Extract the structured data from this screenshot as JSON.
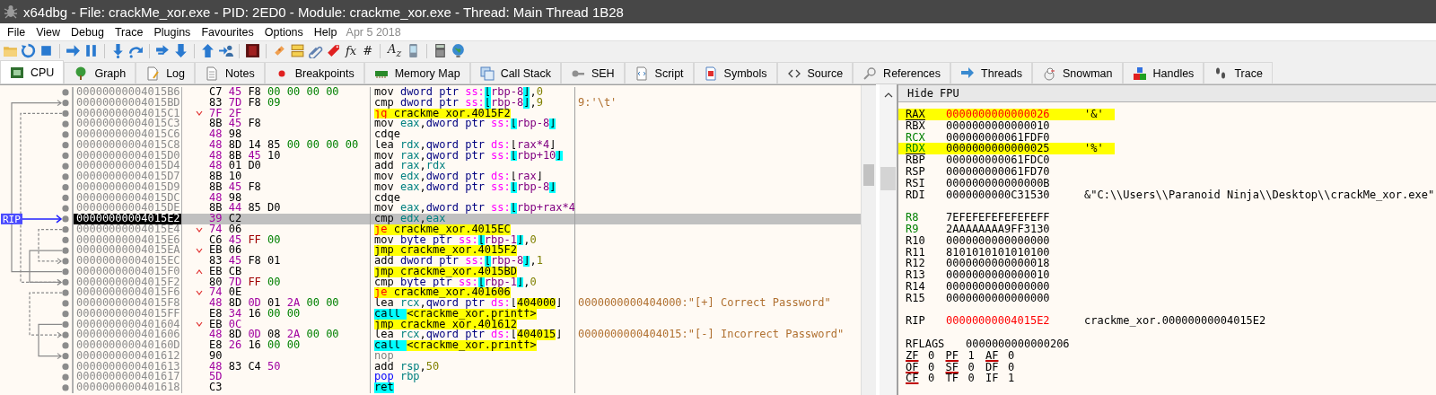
{
  "window": {
    "title": "x64dbg - File: crackMe_xor.exe - PID: 2ED0 - Module: crackme_xor.exe - Thread: Main Thread 1B28"
  },
  "menu": [
    "File",
    "View",
    "Debug",
    "Trace",
    "Plugins",
    "Favourites",
    "Options",
    "Help"
  ],
  "build_date": "Apr 5 2018",
  "toolbar": [
    {
      "kind": "folder"
    },
    {
      "kind": "restart"
    },
    {
      "kind": "stop"
    },
    {
      "kind": "sep"
    },
    {
      "kind": "run"
    },
    {
      "kind": "pause"
    },
    {
      "kind": "sep"
    },
    {
      "kind": "stepinto"
    },
    {
      "kind": "stepover"
    },
    {
      "kind": "sep"
    },
    {
      "kind": "runto"
    },
    {
      "kind": "down"
    },
    {
      "kind": "sep"
    },
    {
      "kind": "up"
    },
    {
      "kind": "user"
    },
    {
      "kind": "sep"
    },
    {
      "kind": "square"
    },
    {
      "kind": "sep"
    },
    {
      "kind": "bandage"
    },
    {
      "kind": "comment"
    },
    {
      "kind": "clip"
    },
    {
      "kind": "tag"
    },
    {
      "kind": "text",
      "text": "fx"
    },
    {
      "kind": "text",
      "text": "#"
    },
    {
      "kind": "sep"
    },
    {
      "kind": "text",
      "text": "A$_{z}$"
    },
    {
      "kind": "phone"
    },
    {
      "kind": "sep"
    },
    {
      "kind": "calc"
    },
    {
      "kind": "globe"
    }
  ],
  "tabs": [
    {
      "label": "CPU",
      "kind": "cpu",
      "selected": true
    },
    {
      "label": "Graph",
      "kind": "tree",
      "selected": false
    },
    {
      "label": "Log",
      "kind": "log",
      "selected": false
    },
    {
      "label": "Notes",
      "kind": "notes",
      "selected": false
    },
    {
      "label": "Breakpoints",
      "kind": "dot",
      "selected": false
    },
    {
      "label": "Memory Map",
      "kind": "memory",
      "selected": false
    },
    {
      "label": "Call Stack",
      "kind": "stack",
      "selected": false
    },
    {
      "label": "SEH",
      "kind": "key",
      "selected": false
    },
    {
      "label": "Script",
      "kind": "script",
      "selected": false
    },
    {
      "label": "Symbols",
      "kind": "symbols",
      "selected": false
    },
    {
      "label": "Source",
      "kind": "code",
      "selected": false
    },
    {
      "label": "References",
      "kind": "search",
      "selected": false
    },
    {
      "label": "Threads",
      "kind": "threads",
      "selected": false
    },
    {
      "label": "Snowman",
      "kind": "snowman",
      "selected": false
    },
    {
      "label": "Handles",
      "kind": "blocks",
      "selected": false
    },
    {
      "label": "Trace",
      "kind": "trace",
      "selected": false
    }
  ],
  "disassembly": {
    "rip_marker": "RIP",
    "rows": [
      {
        "address": "00000000004015B6",
        "bytes": [
          {
            "kind": "b",
            "text": "C7"
          },
          {
            "kind": "p",
            "text": "45"
          },
          {
            "kind": "b",
            "text": "F8"
          },
          {
            "kind": "g",
            "text": "00"
          },
          {
            "kind": "g",
            "text": "00"
          },
          {
            "kind": "g",
            "text": "00"
          },
          {
            "kind": "g",
            "text": "00"
          }
        ],
        "asm": [
          {
            "kind": "m",
            "text": "mov "
          },
          {
            "kind": "s",
            "text": "dword ptr "
          },
          {
            "kind": "sg",
            "text": "ss:"
          },
          {
            "kind": "bc",
            "text": "["
          },
          {
            "kind": "mm",
            "text": "rbp-8"
          },
          {
            "kind": "bc",
            "text": "]"
          },
          {
            "kind": "b",
            "text": ","
          },
          {
            "kind": "k",
            "text": "0"
          }
        ],
        "selected": false
      },
      {
        "address": "00000000004015BD",
        "bytes": [
          {
            "kind": "b",
            "text": "83"
          },
          {
            "kind": "p",
            "text": "7D"
          },
          {
            "kind": "b",
            "text": "F8"
          },
          {
            "kind": "g",
            "text": "09"
          }
        ],
        "asm": [
          {
            "kind": "m",
            "text": "cmp "
          },
          {
            "kind": "s",
            "text": "dword ptr "
          },
          {
            "kind": "sg",
            "text": "ss:"
          },
          {
            "kind": "bc",
            "text": "["
          },
          {
            "kind": "mm",
            "text": "rbp-8"
          },
          {
            "kind": "bc",
            "text": "]"
          },
          {
            "kind": "b",
            "text": ","
          },
          {
            "kind": "k",
            "text": "9"
          }
        ],
        "comment": "9:'\\t'",
        "selected": false
      },
      {
        "address": "00000000004015C1",
        "kind": "jump_down",
        "bytes": [
          {
            "kind": "p",
            "text": "7F"
          },
          {
            "kind": "p",
            "text": "2F"
          }
        ],
        "asm": [
          {
            "kind": "j",
            "text": "jg "
          },
          {
            "kind": "l",
            "text": "crackme_xor.4015F2"
          }
        ],
        "selected": false
      },
      {
        "address": "00000000004015C3",
        "bytes": [
          {
            "kind": "b",
            "text": "8B"
          },
          {
            "kind": "p",
            "text": "45"
          },
          {
            "kind": "b",
            "text": "F8"
          }
        ],
        "asm": [
          {
            "kind": "m",
            "text": "mov "
          },
          {
            "kind": "g",
            "text": "eax"
          },
          {
            "kind": "b",
            "text": ","
          },
          {
            "kind": "s",
            "text": "dword ptr "
          },
          {
            "kind": "sg",
            "text": "ss:"
          },
          {
            "kind": "bc",
            "text": "["
          },
          {
            "kind": "mm",
            "text": "rbp-8"
          },
          {
            "kind": "bc",
            "text": "]"
          }
        ],
        "selected": false
      },
      {
        "address": "00000000004015C6",
        "bytes": [
          {
            "kind": "p",
            "text": "48"
          },
          {
            "kind": "b",
            "text": "98"
          }
        ],
        "asm": [
          {
            "kind": "m",
            "text": "cdqe"
          }
        ],
        "selected": false
      },
      {
        "address": "00000000004015C8",
        "bytes": [
          {
            "kind": "p",
            "text": "48"
          },
          {
            "kind": "b",
            "text": "8D"
          },
          {
            "kind": "b",
            "text": "14"
          },
          {
            "kind": "b",
            "text": "85"
          },
          {
            "kind": "g",
            "text": "00"
          },
          {
            "kind": "g",
            "text": "00"
          },
          {
            "kind": "g",
            "text": "00"
          },
          {
            "kind": "g",
            "text": "00"
          }
        ],
        "asm": [
          {
            "kind": "m",
            "text": "lea "
          },
          {
            "kind": "g",
            "text": "rdx"
          },
          {
            "kind": "b",
            "text": ","
          },
          {
            "kind": "s",
            "text": "qword ptr "
          },
          {
            "kind": "sg",
            "text": "ds:"
          },
          {
            "kind": "b",
            "text": "["
          },
          {
            "kind": "mm",
            "text": "rax*4"
          },
          {
            "kind": "b",
            "text": "]"
          }
        ],
        "selected": false
      },
      {
        "address": "00000000004015D0",
        "bytes": [
          {
            "kind": "p",
            "text": "48"
          },
          {
            "kind": "b",
            "text": "8B"
          },
          {
            "kind": "p",
            "text": "45"
          },
          {
            "kind": "b",
            "text": "10"
          }
        ],
        "asm": [
          {
            "kind": "m",
            "text": "mov "
          },
          {
            "kind": "g",
            "text": "rax"
          },
          {
            "kind": "b",
            "text": ","
          },
          {
            "kind": "s",
            "text": "qword ptr "
          },
          {
            "kind": "sg",
            "text": "ss:"
          },
          {
            "kind": "bc",
            "text": "["
          },
          {
            "kind": "mm",
            "text": "rbp+10"
          },
          {
            "kind": "bc",
            "text": "]"
          }
        ],
        "selected": false
      },
      {
        "address": "00000000004015D4",
        "bytes": [
          {
            "kind": "p",
            "text": "48"
          },
          {
            "kind": "b",
            "text": "01"
          },
          {
            "kind": "b",
            "text": "D0"
          }
        ],
        "asm": [
          {
            "kind": "m",
            "text": "add "
          },
          {
            "kind": "g",
            "text": "rax"
          },
          {
            "kind": "b",
            "text": ","
          },
          {
            "kind": "g",
            "text": "rdx"
          }
        ],
        "selected": false
      },
      {
        "address": "00000000004015D7",
        "bytes": [
          {
            "kind": "b",
            "text": "8B"
          },
          {
            "kind": "b",
            "text": "10"
          }
        ],
        "asm": [
          {
            "kind": "m",
            "text": "mov "
          },
          {
            "kind": "g",
            "text": "edx"
          },
          {
            "kind": "b",
            "text": ","
          },
          {
            "kind": "s",
            "text": "dword ptr "
          },
          {
            "kind": "sg",
            "text": "ds:"
          },
          {
            "kind": "b",
            "text": "["
          },
          {
            "kind": "mm",
            "text": "rax"
          },
          {
            "kind": "b",
            "text": "]"
          }
        ],
        "selected": false
      },
      {
        "address": "00000000004015D9",
        "bytes": [
          {
            "kind": "b",
            "text": "8B"
          },
          {
            "kind": "p",
            "text": "45"
          },
          {
            "kind": "b",
            "text": "F8"
          }
        ],
        "asm": [
          {
            "kind": "m",
            "text": "mov "
          },
          {
            "kind": "g",
            "text": "eax"
          },
          {
            "kind": "b",
            "text": ","
          },
          {
            "kind": "s",
            "text": "dword ptr "
          },
          {
            "kind": "sg",
            "text": "ss:"
          },
          {
            "kind": "bc",
            "text": "["
          },
          {
            "kind": "mm",
            "text": "rbp-8"
          },
          {
            "kind": "bc",
            "text": "]"
          }
        ],
        "selected": false
      },
      {
        "address": "00000000004015DC",
        "bytes": [
          {
            "kind": "p",
            "text": "48"
          },
          {
            "kind": "b",
            "text": "98"
          }
        ],
        "asm": [
          {
            "kind": "m",
            "text": "cdqe"
          }
        ],
        "selected": false
      },
      {
        "address": "00000000004015DE",
        "bytes": [
          {
            "kind": "b",
            "text": "8B"
          },
          {
            "kind": "p",
            "text": "44"
          },
          {
            "kind": "b",
            "text": "85"
          },
          {
            "kind": "b",
            "text": "D0"
          }
        ],
        "asm": [
          {
            "kind": "m",
            "text": "mov "
          },
          {
            "kind": "g",
            "text": "eax"
          },
          {
            "kind": "b",
            "text": ","
          },
          {
            "kind": "s",
            "text": "dword ptr "
          },
          {
            "kind": "sg",
            "text": "ss:"
          },
          {
            "kind": "bc",
            "text": "["
          },
          {
            "kind": "mm",
            "text": "rbp+rax*4"
          }
        ],
        "selected": false
      },
      {
        "address": "00000000004015E2",
        "bytes": [
          {
            "kind": "p",
            "text": "39"
          },
          {
            "kind": "b",
            "text": "C2"
          }
        ],
        "asm": [
          {
            "kind": "m",
            "text": "cmp "
          },
          {
            "kind": "g",
            "text": "edx"
          },
          {
            "kind": "b",
            "text": ","
          },
          {
            "kind": "g",
            "text": "eax"
          }
        ],
        "selected": true
      },
      {
        "address": "00000000004015E4",
        "kind": "jump_down",
        "bytes": [
          {
            "kind": "p",
            "text": "74"
          },
          {
            "kind": "b",
            "text": "06"
          }
        ],
        "asm": [
          {
            "kind": "j",
            "text": "je "
          },
          {
            "kind": "l",
            "text": "crackme_xor.4015EC"
          }
        ],
        "selected": false
      },
      {
        "address": "00000000004015E6",
        "bytes": [
          {
            "kind": "b",
            "text": "C6"
          },
          {
            "kind": "p",
            "text": "45"
          },
          {
            "kind": "r",
            "text": "FF"
          },
          {
            "kind": "g",
            "text": "00"
          }
        ],
        "asm": [
          {
            "kind": "m",
            "text": "mov "
          },
          {
            "kind": "s",
            "text": "byte ptr "
          },
          {
            "kind": "sg",
            "text": "ss:"
          },
          {
            "kind": "bc",
            "text": "["
          },
          {
            "kind": "mm",
            "text": "rbp-1"
          },
          {
            "kind": "bc",
            "text": "]"
          },
          {
            "kind": "b",
            "text": ","
          },
          {
            "kind": "k",
            "text": "0"
          }
        ],
        "selected": false
      },
      {
        "address": "00000000004015EA",
        "kind": "jump_down",
        "bytes": [
          {
            "kind": "b",
            "text": "EB"
          },
          {
            "kind": "b",
            "text": "06"
          }
        ],
        "asm": [
          {
            "kind": "jm",
            "text": "jmp "
          },
          {
            "kind": "l",
            "text": "crackme_xor.4015F2"
          }
        ],
        "selected": false
      },
      {
        "address": "00000000004015EC",
        "bytes": [
          {
            "kind": "b",
            "text": "83"
          },
          {
            "kind": "p",
            "text": "45"
          },
          {
            "kind": "b",
            "text": "F8"
          },
          {
            "kind": "b",
            "text": "01"
          }
        ],
        "asm": [
          {
            "kind": "m",
            "text": "add "
          },
          {
            "kind": "s",
            "text": "dword ptr "
          },
          {
            "kind": "sg",
            "text": "ss:"
          },
          {
            "kind": "bc",
            "text": "["
          },
          {
            "kind": "mm",
            "text": "rbp-8"
          },
          {
            "kind": "bc",
            "text": "]"
          },
          {
            "kind": "b",
            "text": ","
          },
          {
            "kind": "k",
            "text": "1"
          }
        ],
        "selected": false
      },
      {
        "address": "00000000004015F0",
        "kind": "jump_up",
        "bytes": [
          {
            "kind": "b",
            "text": "EB"
          },
          {
            "kind": "b",
            "text": "CB"
          }
        ],
        "asm": [
          {
            "kind": "jm",
            "text": "jmp "
          },
          {
            "kind": "l",
            "text": "crackme_xor.4015BD"
          }
        ],
        "selected": false
      },
      {
        "address": "00000000004015F2",
        "bytes": [
          {
            "kind": "b",
            "text": "80"
          },
          {
            "kind": "p",
            "text": "7D"
          },
          {
            "kind": "r",
            "text": "FF"
          },
          {
            "kind": "g",
            "text": "00"
          }
        ],
        "asm": [
          {
            "kind": "m",
            "text": "cmp "
          },
          {
            "kind": "s",
            "text": "byte ptr "
          },
          {
            "kind": "sg",
            "text": "ss:"
          },
          {
            "kind": "bc",
            "text": "["
          },
          {
            "kind": "mm",
            "text": "rbp-1"
          },
          {
            "kind": "bc",
            "text": "]"
          },
          {
            "kind": "b",
            "text": ","
          },
          {
            "kind": "k",
            "text": "0"
          }
        ],
        "selected": false
      },
      {
        "address": "00000000004015F6",
        "kind": "jump_down",
        "bytes": [
          {
            "kind": "p",
            "text": "74"
          },
          {
            "kind": "b",
            "text": "0E"
          }
        ],
        "asm": [
          {
            "kind": "j",
            "text": "je "
          },
          {
            "kind": "l",
            "text": "crackme_xor.401606"
          }
        ],
        "selected": false
      },
      {
        "address": "00000000004015F8",
        "bytes": [
          {
            "kind": "p",
            "text": "48"
          },
          {
            "kind": "b",
            "text": "8D"
          },
          {
            "kind": "p",
            "text": "0D"
          },
          {
            "kind": "b",
            "text": "01"
          },
          {
            "kind": "p",
            "text": "2A"
          },
          {
            "kind": "g",
            "text": "00"
          },
          {
            "kind": "g",
            "text": "00"
          }
        ],
        "asm": [
          {
            "kind": "m",
            "text": "lea "
          },
          {
            "kind": "g",
            "text": "rcx"
          },
          {
            "kind": "b",
            "text": ","
          },
          {
            "kind": "s",
            "text": "qword ptr "
          },
          {
            "kind": "sg",
            "text": "ds:"
          },
          {
            "kind": "b",
            "text": "["
          },
          {
            "kind": "l",
            "text": "404000"
          },
          {
            "kind": "b",
            "text": "]"
          }
        ],
        "comment": "0000000000404000:\"[+] Correct Password\"",
        "selected": false
      },
      {
        "address": "00000000004015FF",
        "bytes": [
          {
            "kind": "b",
            "text": "E8"
          },
          {
            "kind": "p",
            "text": "34"
          },
          {
            "kind": "b",
            "text": "16"
          },
          {
            "kind": "g",
            "text": "00"
          },
          {
            "kind": "g",
            "text": "00"
          }
        ],
        "asm": [
          {
            "kind": "c",
            "text": "call "
          },
          {
            "kind": "l",
            "text": "<crackme_xor.printf>"
          }
        ],
        "selected": false
      },
      {
        "address": "0000000000401604",
        "kind": "jump_down",
        "bytes": [
          {
            "kind": "b",
            "text": "EB"
          },
          {
            "kind": "p",
            "text": "0C"
          }
        ],
        "asm": [
          {
            "kind": "jm",
            "text": "jmp "
          },
          {
            "kind": "l",
            "text": "crackme_xor.401612"
          }
        ],
        "selected": false
      },
      {
        "address": "0000000000401606",
        "bytes": [
          {
            "kind": "p",
            "text": "48"
          },
          {
            "kind": "b",
            "text": "8D"
          },
          {
            "kind": "p",
            "text": "0D"
          },
          {
            "kind": "b",
            "text": "08"
          },
          {
            "kind": "p",
            "text": "2A"
          },
          {
            "kind": "g",
            "text": "00"
          },
          {
            "kind": "g",
            "text": "00"
          }
        ],
        "asm": [
          {
            "kind": "m",
            "text": "lea "
          },
          {
            "kind": "g",
            "text": "rcx"
          },
          {
            "kind": "b",
            "text": ","
          },
          {
            "kind": "s",
            "text": "qword ptr "
          },
          {
            "kind": "sg",
            "text": "ds:"
          },
          {
            "kind": "b",
            "text": "["
          },
          {
            "kind": "l",
            "text": "404015"
          },
          {
            "kind": "b",
            "text": "]"
          }
        ],
        "comment": "0000000000404015:\"[-] Incorrect Password\"",
        "selected": false
      },
      {
        "address": "000000000040160D",
        "bytes": [
          {
            "kind": "b",
            "text": "E8"
          },
          {
            "kind": "p",
            "text": "26"
          },
          {
            "kind": "b",
            "text": "16"
          },
          {
            "kind": "g",
            "text": "00"
          },
          {
            "kind": "g",
            "text": "00"
          }
        ],
        "asm": [
          {
            "kind": "c",
            "text": "call "
          },
          {
            "kind": "l",
            "text": "<crackme_xor.printf>"
          }
        ],
        "selected": false
      },
      {
        "address": "0000000000401612",
        "bytes": [
          {
            "kind": "b",
            "text": "90"
          }
        ],
        "asm": [
          {
            "kind": "n",
            "text": "nop"
          }
        ],
        "selected": false
      },
      {
        "address": "0000000000401613",
        "bytes": [
          {
            "kind": "p",
            "text": "48"
          },
          {
            "kind": "b",
            "text": "83"
          },
          {
            "kind": "b",
            "text": "C4"
          },
          {
            "kind": "p",
            "text": "50"
          }
        ],
        "asm": [
          {
            "kind": "m",
            "text": "add "
          },
          {
            "kind": "g",
            "text": "rsp"
          },
          {
            "kind": "b",
            "text": ","
          },
          {
            "kind": "k",
            "text": "50"
          }
        ],
        "selected": false
      },
      {
        "address": "0000000000401617",
        "bytes": [
          {
            "kind": "p",
            "text": "5D"
          }
        ],
        "asm": [
          {
            "kind": "pp",
            "text": "pop "
          },
          {
            "kind": "g",
            "text": "rbp"
          }
        ],
        "selected": false
      },
      {
        "address": "0000000000401618",
        "bytes": [
          {
            "kind": "b",
            "text": "C3"
          }
        ],
        "asm": [
          {
            "kind": "c",
            "text": "ret"
          }
        ],
        "selected": false
      }
    ]
  },
  "registers": {
    "header_button": "Hide FPU",
    "groups": [
      [
        {
          "name": "RAX",
          "value": "0000000000000026",
          "comment": "'&'",
          "changed": true,
          "highlighted": true,
          "underlined": true,
          "argument": false
        },
        {
          "name": "RBX",
          "value": "0000000000000010",
          "changed": false,
          "highlighted": false,
          "underlined": false,
          "argument": false
        },
        {
          "name": "RCX",
          "value": "000000000061FDF0",
          "changed": false,
          "highlighted": false,
          "underlined": false,
          "argument": true
        },
        {
          "name": "RDX",
          "value": "0000000000000025",
          "comment": "'%'",
          "changed": false,
          "highlighted": true,
          "underlined": true,
          "argument": true
        },
        {
          "name": "RBP",
          "value": "000000000061FDC0",
          "changed": false,
          "highlighted": false,
          "underlined": false,
          "argument": false
        },
        {
          "name": "RSP",
          "value": "000000000061FD70",
          "changed": false,
          "highlighted": false,
          "underlined": false,
          "argument": false
        },
        {
          "name": "RSI",
          "value": "000000000000000B",
          "changed": false,
          "highlighted": false,
          "underlined": false,
          "argument": false
        },
        {
          "name": "RDI",
          "value": "0000000000C31530",
          "comment": "&\"C:\\\\Users\\\\Paranoid Ninja\\\\Desktop\\\\crackMe_xor.exe\"",
          "changed": false,
          "highlighted": false,
          "underlined": false,
          "argument": false
        }
      ],
      [
        {
          "name": "R8",
          "value": "7EFEFEFEFEFEFEFF",
          "changed": false,
          "highlighted": false,
          "underlined": false,
          "argument": true
        },
        {
          "name": "R9",
          "value": "2AAAAAAAA9FF3130",
          "changed": false,
          "highlighted": false,
          "underlined": false,
          "argument": true
        },
        {
          "name": "R10",
          "value": "0000000000000000",
          "changed": false,
          "highlighted": false,
          "underlined": false,
          "argument": false
        },
        {
          "name": "R11",
          "value": "8101010101010100",
          "changed": false,
          "highlighted": false,
          "underlined": false,
          "argument": false
        },
        {
          "name": "R12",
          "value": "0000000000000018",
          "changed": false,
          "highlighted": false,
          "underlined": false,
          "argument": false
        },
        {
          "name": "R13",
          "value": "0000000000000010",
          "changed": false,
          "highlighted": false,
          "underlined": false,
          "argument": false
        },
        {
          "name": "R14",
          "value": "0000000000000000",
          "changed": false,
          "highlighted": false,
          "underlined": false,
          "argument": false
        },
        {
          "name": "R15",
          "value": "0000000000000000",
          "changed": false,
          "highlighted": false,
          "underlined": false,
          "argument": false
        }
      ],
      [
        {
          "name": "RIP",
          "value": "00000000004015E2",
          "comment": "crackme_xor.00000000004015E2",
          "changed": true,
          "highlighted": false,
          "underlined": false,
          "argument": false
        }
      ]
    ],
    "rflags": {
      "name": "RFLAGS",
      "value": "0000000000000206"
    },
    "flags": [
      {
        "name": "ZF",
        "value": "0",
        "underlined": true
      },
      {
        "name": "PF",
        "value": "1",
        "underlined": true
      },
      {
        "name": "AF",
        "value": "0",
        "underlined": true
      },
      {
        "name": "OF",
        "value": "0",
        "underlined": true
      },
      {
        "name": "SF",
        "value": "0",
        "underlined": true
      },
      {
        "name": "DF",
        "value": "0",
        "underlined": false
      },
      {
        "name": "CF",
        "value": "0",
        "underlined": true
      },
      {
        "name": "TF",
        "value": "0",
        "underlined": false
      },
      {
        "name": "IF",
        "value": "1",
        "underlined": false
      }
    ]
  }
}
